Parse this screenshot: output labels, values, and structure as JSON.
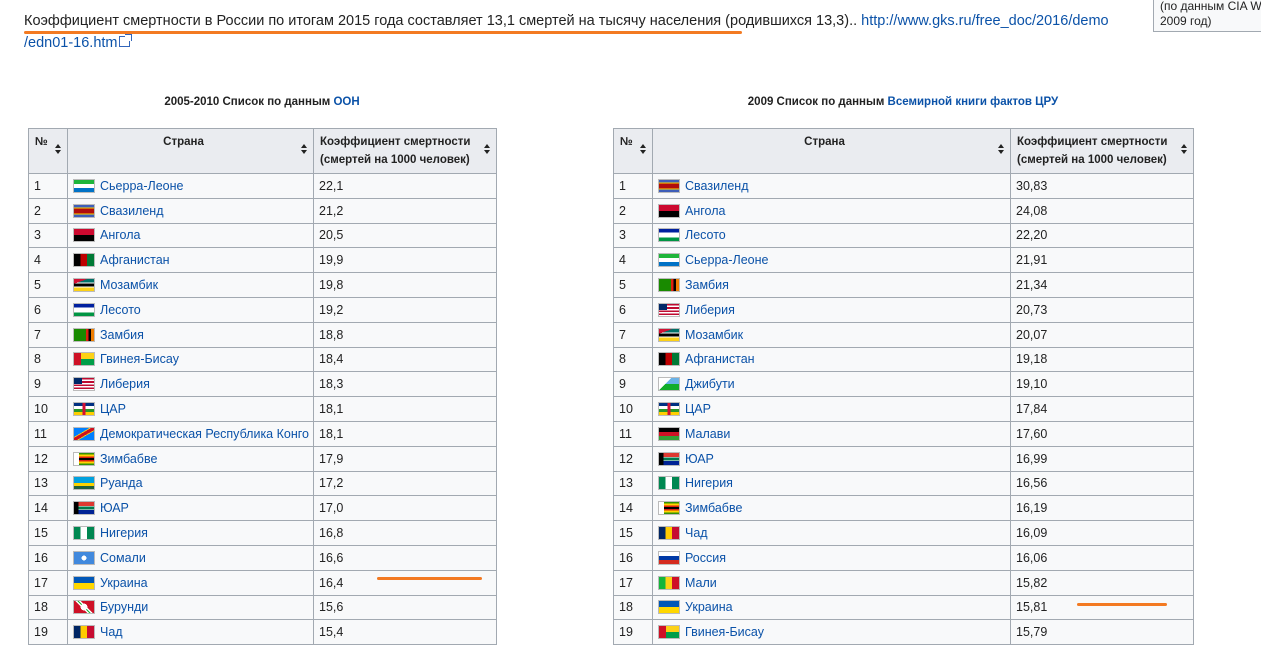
{
  "intro": {
    "text": "Коэффициент смертности в России по итогам 2015 года составляет 13,1 смертей на тысячу населения (родившихся 13,3).. ",
    "url_part1": "http://www.gks.ru/free_doc/2016/demo",
    "url_part2": "/edn01-16.htm"
  },
  "infobox": {
    "line1": "(по данным CIA W",
    "line2": "2009 год)"
  },
  "left": {
    "caption_prefix": "2005-2010 Список по данным ",
    "caption_link": "ООН",
    "headers": [
      "№",
      "Страна",
      "Коэффициент смертности (смертей на 1000 человек)"
    ],
    "rows": [
      {
        "n": "1",
        "country": "Сьерра-Леоне",
        "value": "22,1",
        "flag": "sierra-leone"
      },
      {
        "n": "2",
        "country": "Свазиленд",
        "value": "21,2",
        "flag": "swaziland"
      },
      {
        "n": "3",
        "country": "Ангола",
        "value": "20,5",
        "flag": "angola"
      },
      {
        "n": "4",
        "country": "Афганистан",
        "value": "19,9",
        "flag": "afghanistan"
      },
      {
        "n": "5",
        "country": "Мозамбик",
        "value": "19,8",
        "flag": "mozambique"
      },
      {
        "n": "6",
        "country": "Лесото",
        "value": "19,2",
        "flag": "lesotho"
      },
      {
        "n": "7",
        "country": "Замбия",
        "value": "18,8",
        "flag": "zambia"
      },
      {
        "n": "8",
        "country": "Гвинея-Бисау",
        "value": "18,4",
        "flag": "guinea-bissau"
      },
      {
        "n": "9",
        "country": "Либерия",
        "value": "18,3",
        "flag": "liberia"
      },
      {
        "n": "10",
        "country": "ЦАР",
        "value": "18,1",
        "flag": "car"
      },
      {
        "n": "11",
        "country": "Демократическая Республика Конго",
        "value": "18,1",
        "flag": "drc"
      },
      {
        "n": "12",
        "country": "Зимбабве",
        "value": "17,9",
        "flag": "zimbabwe"
      },
      {
        "n": "13",
        "country": "Руанда",
        "value": "17,2",
        "flag": "rwanda"
      },
      {
        "n": "14",
        "country": "ЮАР",
        "value": "17,0",
        "flag": "south-africa"
      },
      {
        "n": "15",
        "country": "Нигерия",
        "value": "16,8",
        "flag": "nigeria"
      },
      {
        "n": "16",
        "country": "Сомали",
        "value": "16,6",
        "flag": "somalia"
      },
      {
        "n": "17",
        "country": "Украина",
        "value": "16,4",
        "flag": "ukraine"
      },
      {
        "n": "18",
        "country": "Бурунди",
        "value": "15,6",
        "flag": "burundi"
      },
      {
        "n": "19",
        "country": "Чад",
        "value": "15,4",
        "flag": "chad"
      }
    ]
  },
  "right": {
    "caption_prefix": "2009 Список по данным ",
    "caption_link": "Всемирной книги фактов ЦРУ",
    "headers": [
      "№",
      "Страна",
      "Коэффициент смертности (смертей на 1000 человек)"
    ],
    "rows": [
      {
        "n": "1",
        "country": "Свазиленд",
        "value": "30,83",
        "flag": "swaziland"
      },
      {
        "n": "2",
        "country": "Ангола",
        "value": "24,08",
        "flag": "angola"
      },
      {
        "n": "3",
        "country": "Лесото",
        "value": "22,20",
        "flag": "lesotho"
      },
      {
        "n": "4",
        "country": "Сьерра-Леоне",
        "value": "21,91",
        "flag": "sierra-leone"
      },
      {
        "n": "5",
        "country": "Замбия",
        "value": "21,34",
        "flag": "zambia"
      },
      {
        "n": "6",
        "country": "Либерия",
        "value": "20,73",
        "flag": "liberia"
      },
      {
        "n": "7",
        "country": "Мозамбик",
        "value": "20,07",
        "flag": "mozambique"
      },
      {
        "n": "8",
        "country": "Афганистан",
        "value": "19,18",
        "flag": "afghanistan"
      },
      {
        "n": "9",
        "country": "Джибути",
        "value": "19,10",
        "flag": "djibouti"
      },
      {
        "n": "10",
        "country": "ЦАР",
        "value": "17,84",
        "flag": "car"
      },
      {
        "n": "11",
        "country": "Малави",
        "value": "17,60",
        "flag": "malawi"
      },
      {
        "n": "12",
        "country": "ЮАР",
        "value": "16,99",
        "flag": "south-africa"
      },
      {
        "n": "13",
        "country": "Нигерия",
        "value": "16,56",
        "flag": "nigeria"
      },
      {
        "n": "14",
        "country": "Зимбабве",
        "value": "16,19",
        "flag": "zimbabwe"
      },
      {
        "n": "15",
        "country": "Чад",
        "value": "16,09",
        "flag": "chad"
      },
      {
        "n": "16",
        "country": "Россия",
        "value": "16,06",
        "flag": "russia"
      },
      {
        "n": "17",
        "country": "Мали",
        "value": "15,82",
        "flag": "mali"
      },
      {
        "n": "18",
        "country": "Украина",
        "value": "15,81",
        "flag": "ukraine"
      },
      {
        "n": "19",
        "country": "Гвинея-Бисау",
        "value": "15,79",
        "flag": "guinea-bissau"
      }
    ]
  },
  "colors": {
    "link": "#0b52a8",
    "highlight_mark": "#f37a22",
    "header_bg": "#eaecf0",
    "cell_bg": "#f8f9fa",
    "border": "#a2a9b1"
  }
}
